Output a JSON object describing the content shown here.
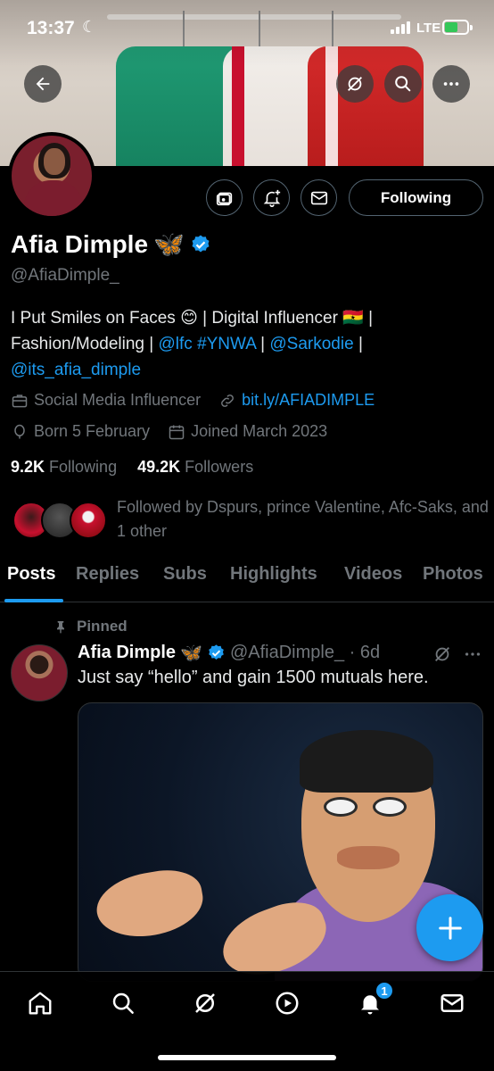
{
  "status_bar": {
    "time": "13:37",
    "network": "LTE"
  },
  "profile": {
    "name": "Afia Dimple",
    "name_emoji": "🦋",
    "handle": "@AfiaDimple_",
    "bio_segments": [
      {
        "text": "I Put Smiles on Faces 😊 | Digital Influencer 🇬🇭 | Fashion/Modeling | ",
        "link": false
      },
      {
        "text": "@lfc",
        "link": true
      },
      {
        "text": " ",
        "link": false
      },
      {
        "text": "#YNWA",
        "link": true
      },
      {
        "text": " | ",
        "link": false
      },
      {
        "text": "@Sarkodie",
        "link": true
      },
      {
        "text": " | ",
        "link": false
      },
      {
        "text": "@its_afia_dimple",
        "link": true
      }
    ],
    "category": "Social Media Influencer",
    "website": "bit.ly/AFIADIMPLE",
    "born": "Born 5 February",
    "joined": "Joined March 2023",
    "following_count": "9.2K",
    "following_label": "Following",
    "followers_count": "49.2K",
    "followers_label": "Followers",
    "followed_by": "Followed by Dspurs, prince Valentine, Afc-Saks, and 1 other",
    "following_button": "Following"
  },
  "tabs": [
    "Posts",
    "Replies",
    "Subs",
    "Highlights",
    "Videos",
    "Photos"
  ],
  "pinned_post": {
    "pinned_label": "Pinned",
    "author": "Afia Dimple",
    "author_emoji": "🦋",
    "handle_time": "@AfiaDimple_ · 6d",
    "text": "Just say “hello” and gain 1500 mutuals here."
  },
  "bottom_nav": {
    "items": [
      "home-icon",
      "search-icon",
      "grok-icon",
      "video-icon",
      "notifications-icon",
      "messages-icon"
    ],
    "notification_badge": "1"
  },
  "colors": {
    "accent": "#1d9bf0",
    "muted": "#71767b",
    "background": "#000000"
  }
}
